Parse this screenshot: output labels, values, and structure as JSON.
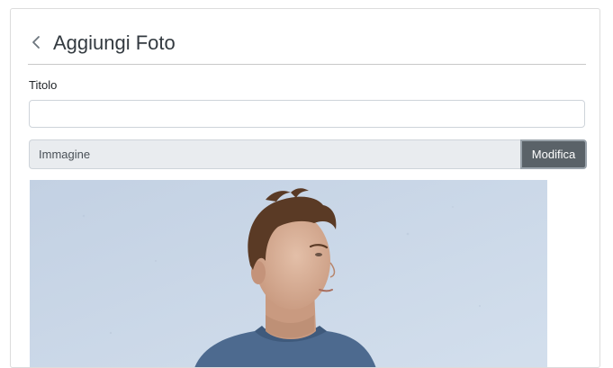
{
  "header": {
    "title": "Aggiungi Foto",
    "back_icon": "chevron-left-icon"
  },
  "form": {
    "title_label": "Titolo",
    "title_value": "",
    "title_placeholder": "",
    "file_label": "Immagine",
    "file_button_label": "Modifica"
  },
  "photo": {
    "content": "teen-boy-portrait-image"
  },
  "colors": {
    "title_text": "#333a40",
    "file_button_bg": "#5a6268",
    "file_label_bg": "#e9ecef",
    "photo_wall": "#c9d6e6",
    "shirt": "#4d6a8f"
  }
}
